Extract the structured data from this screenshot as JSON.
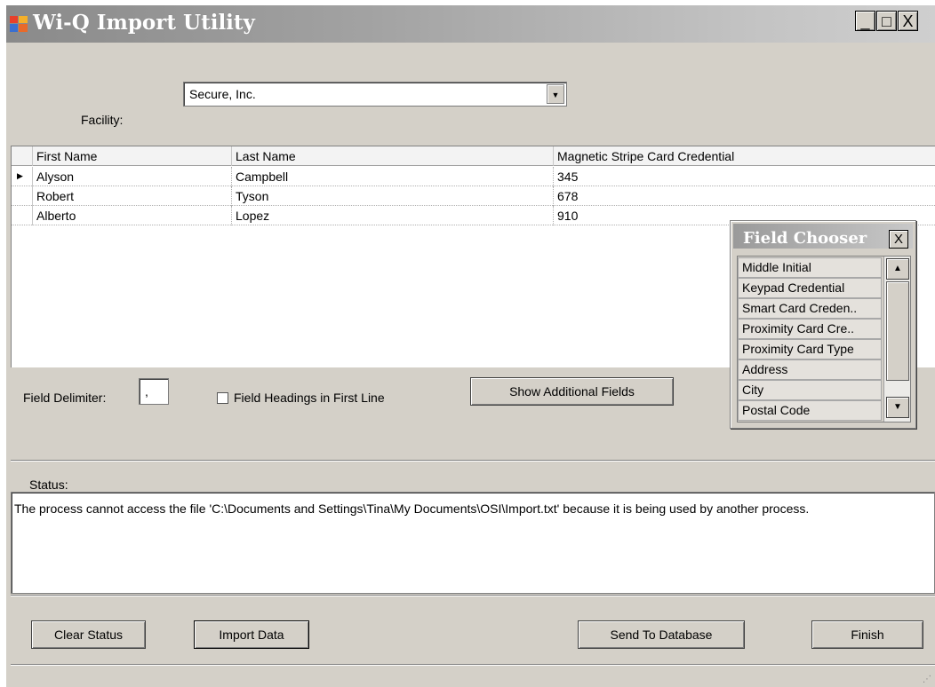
{
  "window": {
    "title": "Wi-Q Import Utility",
    "controls": {
      "minimize": "_",
      "maximize": "□",
      "close": "X"
    }
  },
  "facility": {
    "label": "Facility:",
    "selected": "Secure, Inc."
  },
  "grid": {
    "columns": [
      "First Name",
      "Last Name",
      "Magnetic Stripe Card Credential"
    ],
    "rows": [
      {
        "first": "Alyson",
        "last": "Campbell",
        "card": "345"
      },
      {
        "first": "Robert",
        "last": "Tyson",
        "card": "678"
      },
      {
        "first": "Alberto",
        "last": "Lopez",
        "card": "910"
      }
    ]
  },
  "options": {
    "delimiter_label": "Field Delimiter:",
    "delimiter_value": ",",
    "headings_label": "Field Headings in First Line",
    "headings_checked": false,
    "show_fields_button": "Show Additional Fields"
  },
  "field_chooser": {
    "title": "Field Chooser",
    "close": "X",
    "items": [
      "Middle Initial",
      "Keypad Credential",
      "Smart Card Creden..",
      "Proximity Card Cre..",
      "Proximity Card Type",
      "Address",
      "City",
      "Postal Code"
    ]
  },
  "status": {
    "label": "Status:",
    "message": "The process cannot access the file 'C:\\Documents and Settings\\Tina\\My Documents\\OSI\\Import.txt' because it is being used by another process."
  },
  "buttons": {
    "clear_status": "Clear Status",
    "import_data": "Import Data",
    "send_to_database": "Send To Database",
    "finish": "Finish"
  }
}
